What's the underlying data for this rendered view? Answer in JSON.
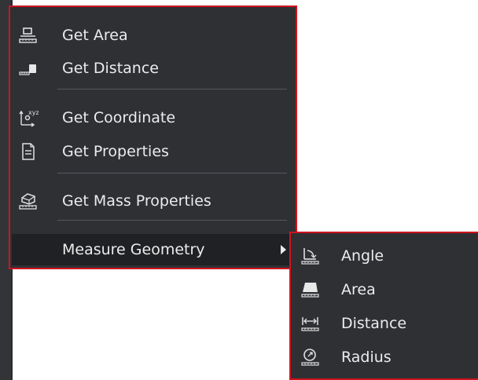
{
  "menu": {
    "items": [
      {
        "label": "Get Area",
        "icon": "area-ruler-icon"
      },
      {
        "label": "Get Distance",
        "icon": "distance-ruler-icon"
      },
      {
        "label": "Get Coordinate",
        "icon": "xyz-coordinate-icon"
      },
      {
        "label": "Get Properties",
        "icon": "properties-document-icon"
      },
      {
        "label": "Get Mass Properties",
        "icon": "mass-properties-icon"
      },
      {
        "label": "Measure Geometry",
        "icon": "submenu-arrow-icon"
      }
    ]
  },
  "submenu": {
    "items": [
      {
        "label": "Angle",
        "icon": "angle-measure-icon"
      },
      {
        "label": "Area",
        "icon": "area-measure-icon"
      },
      {
        "label": "Distance",
        "icon": "distance-measure-icon"
      },
      {
        "label": "Radius",
        "icon": "radius-measure-icon"
      }
    ]
  },
  "colors": {
    "menu_background": "#2e3034",
    "highlight_background": "#1f2124",
    "border_red": "#d0141f",
    "text": "#ececec"
  }
}
